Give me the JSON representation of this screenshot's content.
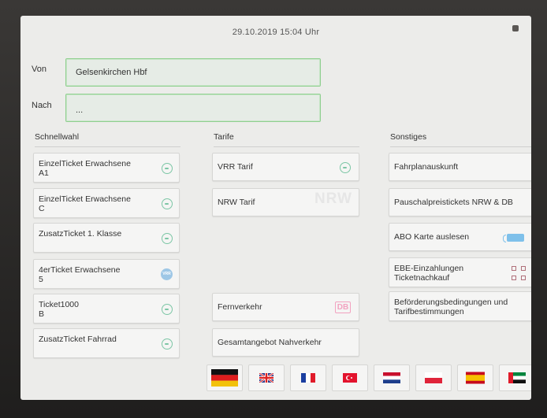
{
  "header": {
    "datetime": "29.10.2019 15:04 Uhr"
  },
  "route": {
    "from_label": "Von",
    "from_value": "Gelsenkirchen Hbf",
    "to_label": "Nach",
    "to_value": "..."
  },
  "columns": {
    "schnellwahl": "Schnellwahl",
    "tarife": "Tarife",
    "sonstiges": "Sonstiges"
  },
  "schnellwahl": [
    {
      "label": "EinzelTicket Erwachsene\nA1",
      "icon": "circle-icon"
    },
    {
      "label": "EinzelTicket Erwachsene\nC",
      "icon": "circle-icon"
    },
    {
      "label": "ZusatzTicket 1. Klasse",
      "icon": "circle-icon"
    },
    {
      "label": "4erTicket Erwachsene\n5",
      "icon": "vrr-icon"
    },
    {
      "label": "Ticket1000\nB",
      "icon": "circle-icon"
    },
    {
      "label": "ZusatzTicket Fahrrad",
      "icon": "circle-icon"
    }
  ],
  "tarife": [
    {
      "label": "VRR Tarif",
      "icon": "circle-icon"
    },
    {
      "label": "NRW Tarif",
      "icon_text": "NRW"
    },
    {
      "label": "Fernverkehr",
      "icon_text": "DB"
    },
    {
      "label": "Gesamtangebot Nahverkehr"
    }
  ],
  "sonstiges": [
    {
      "label": "Fahrplanauskunft"
    },
    {
      "label": "Pauschalpreistickets NRW & DB"
    },
    {
      "label": "ABO Karte auslesen",
      "icon": "card-reader-icon"
    },
    {
      "label": "EBE-Einzahlungen\nTicketnachkauf",
      "icon": "qr-code-icon"
    },
    {
      "label": "Beförderungsbedingungen und\nTarifbestimmungen"
    }
  ],
  "vrr_icon_text": "VRR",
  "languages": [
    "german",
    "english",
    "french",
    "turkish",
    "dutch",
    "polish",
    "spanish",
    "arabic"
  ],
  "colors": {
    "accent_green": "#7cc6a5",
    "field_border": "#8fcf8f",
    "db_pink": "#f2a2c0"
  }
}
